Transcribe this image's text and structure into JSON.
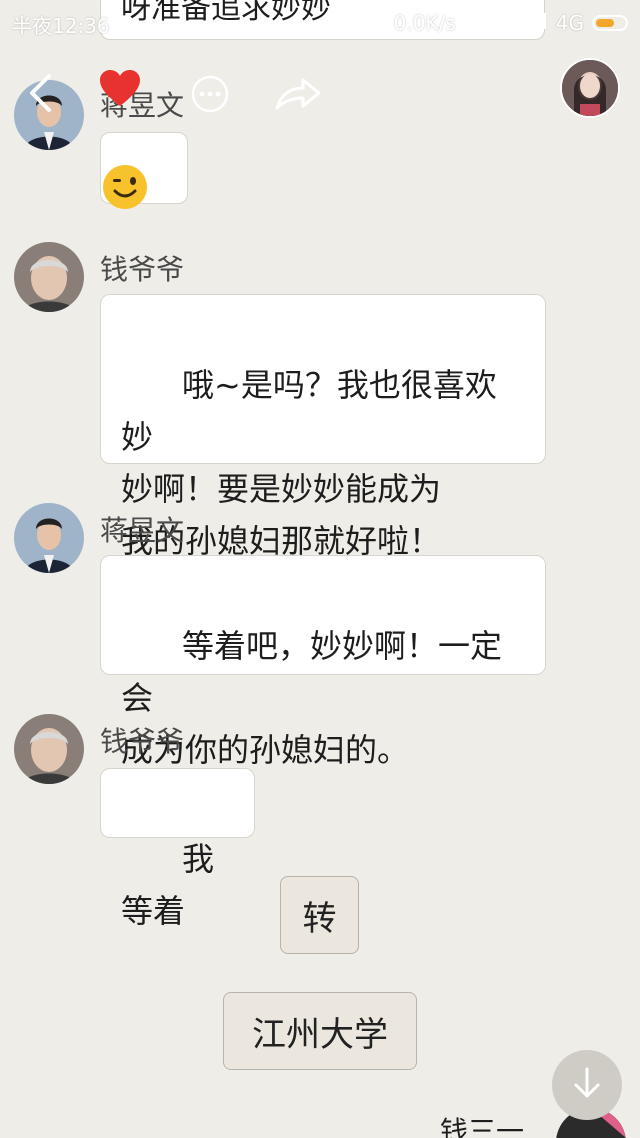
{
  "status_bar": {
    "time": "半夜12:36",
    "network_speed": "0.0K/s",
    "network_type": "4G",
    "icons": [
      "headphones-icon",
      "signal-weak-icon",
      "signal-icon",
      "battery-icon"
    ]
  },
  "top_partial_message": {
    "text": "呀准备追求妙妙"
  },
  "overlay": {
    "icons": [
      "back-icon",
      "heart-icon",
      "more-icon",
      "share-icon"
    ],
    "heart_color": "#e8322f"
  },
  "messages": [
    {
      "sender": "蒋昱文",
      "type": "emoji",
      "content": "wink-emoji"
    },
    {
      "sender": "钱爷爷",
      "type": "text",
      "content": "哦~是吗？我也很喜欢妙\n妙啊！要是妙妙能成为\n我的孙媳妇那就好啦！"
    },
    {
      "sender": "蒋昱文",
      "type": "text",
      "content": "等着吧，妙妙啊！一定会\n成为你的孙媳妇的。"
    },
    {
      "sender": "钱爷爷",
      "type": "text",
      "content": "我等着"
    }
  ],
  "center_buttons": [
    {
      "label": "转"
    },
    {
      "label": "江州大学"
    }
  ],
  "bottom": {
    "partial_sender": "钱三一"
  },
  "colors": {
    "background": "#efede8",
    "bubble": "#ffffff",
    "accent_battery": "#f2a72a",
    "emoji_yellow": "#f8c22c"
  }
}
